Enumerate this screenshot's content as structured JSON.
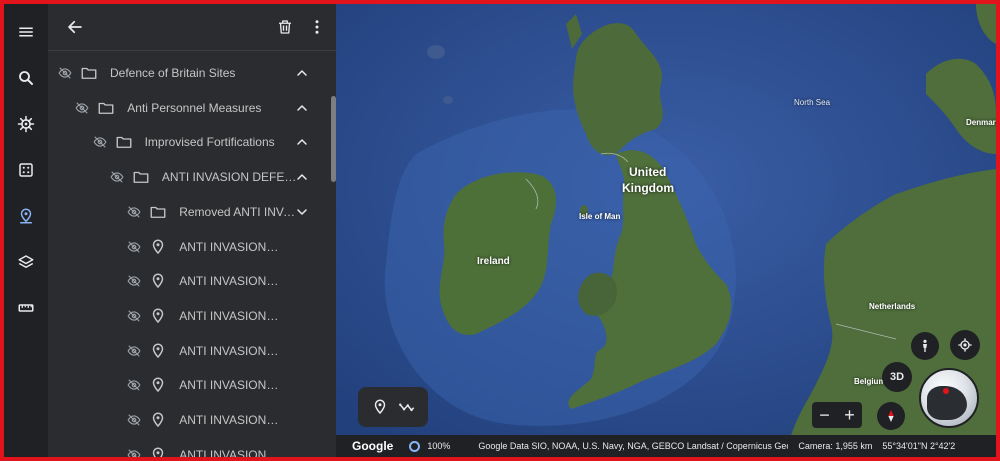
{
  "sidebar_rail": {
    "items": [
      {
        "name": "menu",
        "icon": "menu-icon"
      },
      {
        "name": "search",
        "icon": "search-icon"
      },
      {
        "name": "voyager",
        "icon": "ship-wheel-icon"
      },
      {
        "name": "feeling-lucky",
        "icon": "dice-icon"
      },
      {
        "name": "projects",
        "icon": "projects-pin-icon",
        "active": true
      },
      {
        "name": "map-style",
        "icon": "layers-icon"
      },
      {
        "name": "measure",
        "icon": "ruler-icon"
      }
    ]
  },
  "panel": {
    "header": {
      "back_icon": "arrow-left-icon",
      "delete_icon": "trash-icon",
      "more_icon": "more-vert-icon"
    },
    "tree": [
      {
        "label": "Defence of Britain Sites",
        "type": "folder",
        "level": 0,
        "expanded": true
      },
      {
        "label": "Anti Personnel Measures",
        "type": "folder",
        "level": 1,
        "expanded": true
      },
      {
        "label": "Improvised Fortifications",
        "type": "folder",
        "level": 2,
        "expanded": true
      },
      {
        "label": "ANTI INVASION DEFENCE",
        "type": "folder",
        "level": 3,
        "expanded": true
      },
      {
        "label": "Removed ANTI INVASION",
        "type": "folder",
        "level": 4,
        "expanded": false
      },
      {
        "label": "ANTI INVASION DEFENCE",
        "type": "placemark",
        "level": 4
      },
      {
        "label": "ANTI INVASION DEFENCE",
        "type": "placemark",
        "level": 4
      },
      {
        "label": "ANTI INVASION DEFENCE",
        "type": "placemark",
        "level": 4
      },
      {
        "label": "ANTI INVASION DEFENCE",
        "type": "placemark",
        "level": 4
      },
      {
        "label": "ANTI INVASION DEFENCE",
        "type": "placemark",
        "level": 4
      },
      {
        "label": "ANTI INVASION DEFENCE",
        "type": "placemark",
        "level": 4
      },
      {
        "label": "ANTI INVASION DEFENCE",
        "type": "placemark",
        "level": 4
      }
    ]
  },
  "map": {
    "labels": {
      "north_sea": "North Sea",
      "uk_line1": "United",
      "uk_line2": "Kingdom",
      "isle_of_man": "Isle of Man",
      "ireland": "Ireland",
      "netherlands": "Netherlands",
      "belgium": "Belgium",
      "denmark": "Denmark"
    },
    "tools": {
      "placemark_icon": "placemark-icon",
      "path_icon": "path-icon"
    },
    "controls": {
      "three_d": "3D",
      "pegman_icon": "pegman-icon",
      "locate_icon": "my-location-icon",
      "compass_icon": "compass-icon",
      "zoom_out": "−",
      "zoom_in": "+"
    }
  },
  "status_bar": {
    "logo": "Google",
    "load_percent": "100%",
    "credits": "Google  Data SIO, NOAA, U.S. Navy, NGA, GEBCO  Landsat / Copernicus  GeoBasis",
    "camera": "Camera: 1,955 km",
    "coords": "55°34'01\"N 2°42'2"
  },
  "colors": {
    "accent": "#8ab4f8",
    "frame": "#e1131b",
    "panel": "#2b2c2f",
    "rail": "#202124",
    "sea": "#2e4c8c"
  }
}
